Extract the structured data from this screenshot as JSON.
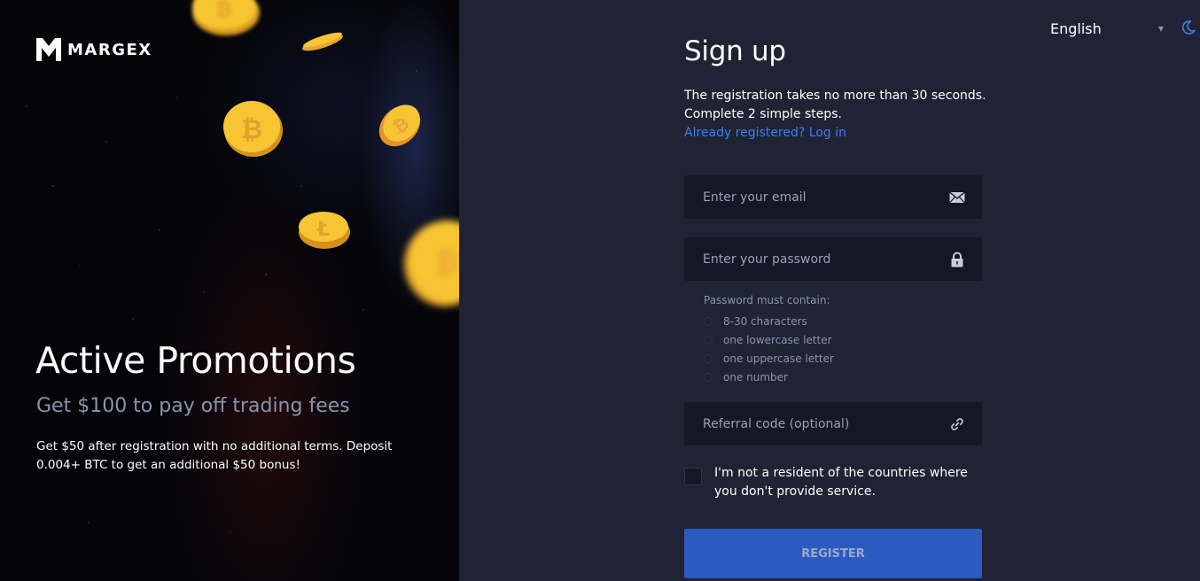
{
  "brand": {
    "name": "MARGEX"
  },
  "promo": {
    "title": "Active Promotions",
    "subtitle": "Get $100 to pay off trading fees",
    "description": "Get $50 after registration with no additional terms. Deposit 0.004+ BTC to get an additional $50 bonus!"
  },
  "header": {
    "language": "English",
    "theme_icon": "moon-icon"
  },
  "form": {
    "title": "Sign up",
    "intro_line1": "The registration takes no more than 30 seconds.",
    "intro_line2": "Complete 2 simple steps.",
    "login_link": "Already registered? Log in",
    "email": {
      "placeholder": "Enter your email",
      "value": "",
      "icon": "envelope-icon"
    },
    "password": {
      "placeholder": "Enter your password",
      "value": "",
      "icon": "lock-icon"
    },
    "password_rules": {
      "title": "Password must contain:",
      "items": [
        "8-30 characters",
        "one lowercase letter",
        "one uppercase letter",
        "one number"
      ]
    },
    "referral": {
      "placeholder": "Referral code (optional)",
      "value": "",
      "icon": "link-icon"
    },
    "consent": {
      "checked": false,
      "label": "I'm not a resident of the countries where you don't provide service."
    },
    "submit_label": "REGISTER"
  },
  "colors": {
    "page_background": "#1f2333",
    "input_background": "#131726",
    "accent_link": "#3d7ef5",
    "button": "#2c5bc0",
    "coin_gold": "#f7c533"
  }
}
